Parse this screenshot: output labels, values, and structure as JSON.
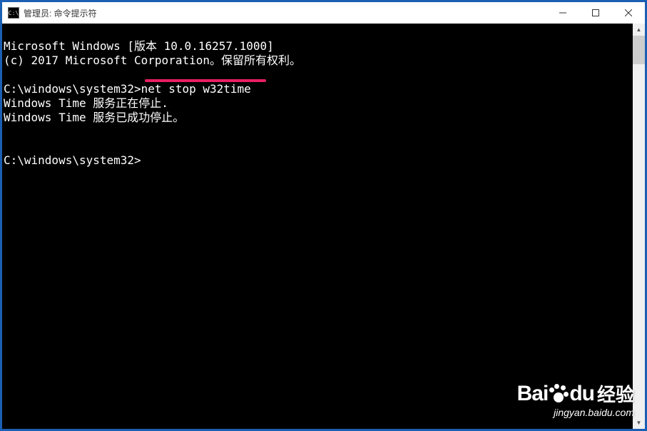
{
  "window": {
    "title": "管理员: 命令提示符"
  },
  "console": {
    "line1": "Microsoft Windows [版本 10.0.16257.1000]",
    "line2": "(c) 2017 Microsoft Corporation。保留所有权利。",
    "line3": "",
    "prompt1": "C:\\windows\\system32>",
    "command1": "net stop w32time",
    "line5": "Windows Time 服务正在停止.",
    "line6": "Windows Time 服务已成功停止。",
    "line7": "",
    "line8": "",
    "prompt2": "C:\\windows\\system32>"
  },
  "watermark": {
    "brand": "Bai",
    "brand2": "du",
    "jy": "经验",
    "url": "jingyan.baidu.com"
  }
}
